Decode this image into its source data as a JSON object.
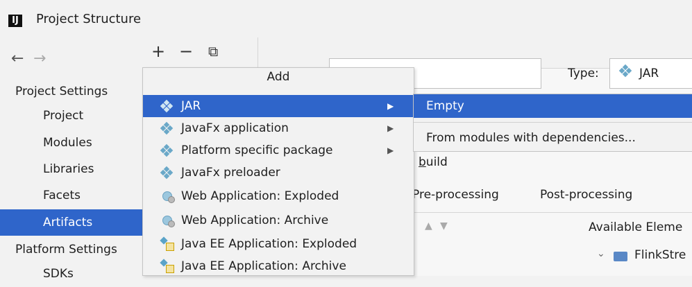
{
  "window": {
    "title": "Project Structure",
    "app_icon_text": "IJ"
  },
  "toolbar": {
    "back_icon": "arrow-left-icon",
    "forward_icon": "arrow-right-icon",
    "add_glyph": "+",
    "remove_glyph": "−",
    "copy_icon": "copy-icon",
    "back_glyph": "←",
    "forward_glyph": "→",
    "copy_glyph": "⧉"
  },
  "sidebar": {
    "project_settings_header": "Project Settings",
    "project_settings_items": [
      "Project",
      "Modules",
      "Libraries",
      "Facets",
      "Artifacts"
    ],
    "selected": "Artifacts",
    "platform_settings_header": "Platform Settings",
    "platform_settings_items": [
      "SDKs"
    ]
  },
  "artifact_form": {
    "name_value": "",
    "type_label": "Type:",
    "type_value": "JAR",
    "build_prefix": "b",
    "build_rest": "uild",
    "tabs": [
      "Pre-processing",
      "Post-processing"
    ],
    "available_elements_label": "Available Eleme",
    "tree_item": "FlinkStre"
  },
  "add_menu": {
    "title": "Add",
    "items": [
      {
        "label": "JAR",
        "icon": "jar-icon",
        "submenu": true,
        "highlighted": true
      },
      {
        "label": "JavaFx application",
        "icon": "jar-icon",
        "submenu": true
      },
      {
        "label": "Platform specific package",
        "icon": "jar-icon",
        "submenu": true
      },
      {
        "label": "JavaFx preloader",
        "icon": "jar-icon",
        "submenu": false
      },
      {
        "label": "Web Application: Exploded",
        "icon": "web-app-icon",
        "submenu": false
      },
      {
        "label": "Web Application: Archive",
        "icon": "web-app-icon",
        "submenu": false
      },
      {
        "label": "Java EE Application: Exploded",
        "icon": "javaee-icon",
        "submenu": false
      },
      {
        "label": "Java EE Application: Archive",
        "icon": "javaee-icon",
        "submenu": false
      }
    ],
    "submenu_arrow": "▶"
  },
  "jar_submenu": {
    "items": [
      "Empty",
      "From modules with dependencies..."
    ],
    "highlighted": "Empty"
  },
  "colors": {
    "selection": "#2f65ca",
    "background": "#f2f2f2"
  }
}
